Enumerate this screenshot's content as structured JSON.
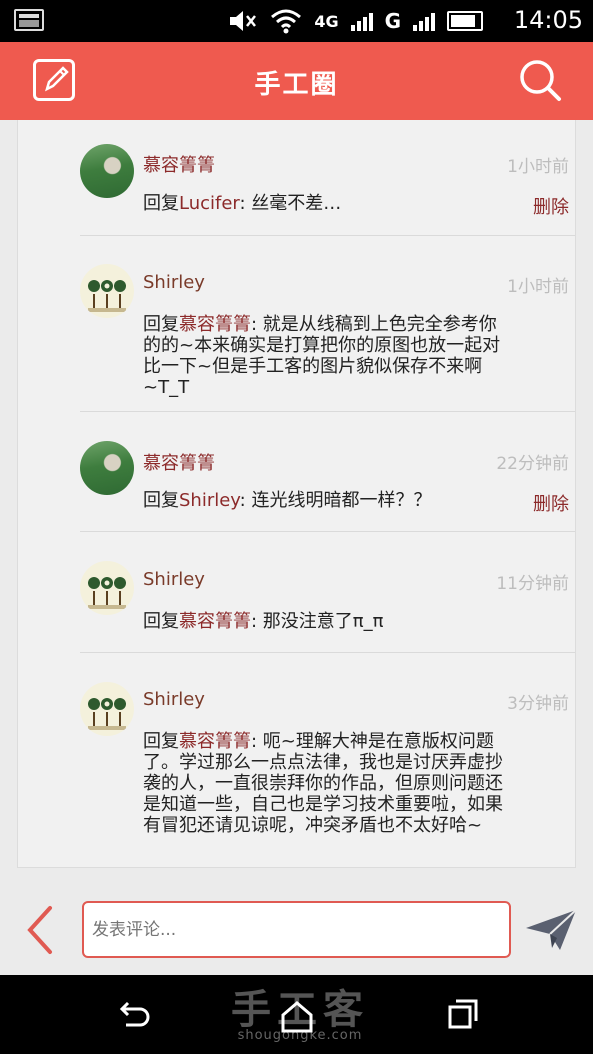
{
  "status_bar": {
    "network": "4G",
    "carrier_letter": "G",
    "time": "14:05"
  },
  "header": {
    "title": "手工圈"
  },
  "comments": [
    {
      "user": "慕容箐箐",
      "time": "1小时前",
      "reply_prefix": "回复",
      "reply_to": "Lucifer",
      "text": ": 丝毫不差…",
      "delete_label": "删除",
      "avatar": "green"
    },
    {
      "user": "Shirley",
      "time": "1小时前",
      "reply_prefix": "回复",
      "reply_to": "慕容箐箐",
      "text": ": 就是从线稿到上色完全参考你的的~本来确实是打算把你的原图也放一起对比一下~但是手工客的图片貌似保存不来啊~T_T",
      "avatar": "flower"
    },
    {
      "user": "慕容箐箐",
      "time": "22分钟前",
      "reply_prefix": "回复",
      "reply_to": "Shirley",
      "text": ": 连光线明暗都一样？？",
      "delete_label": "删除",
      "avatar": "green"
    },
    {
      "user": "Shirley",
      "time": "11分钟前",
      "reply_prefix": "回复",
      "reply_to": "慕容箐箐",
      "text": ": 那没注意了π_π",
      "avatar": "flower"
    },
    {
      "user": "Shirley",
      "time": "3分钟前",
      "reply_prefix": "回复",
      "reply_to": "慕容箐箐",
      "text": ": 呃~理解大神是在意版权问题了。学过那么一点点法律，我也是讨厌弄虚抄袭的人，一直很崇拜你的作品，但原则问题还是知道一些，自己也是学习技术重要啦，如果有冒犯还请见谅呢，冲突矛盾也不太好哈~",
      "avatar": "flower"
    }
  ],
  "input_bar": {
    "placeholder": "发表评论..."
  },
  "watermark": {
    "text": "手工客",
    "url": "shougongke.com"
  },
  "colors": {
    "header_bg": "#ef5a4f",
    "username": "#8c2a2a",
    "timestamp": "#bdbdbd",
    "input_border": "#e05a52"
  }
}
